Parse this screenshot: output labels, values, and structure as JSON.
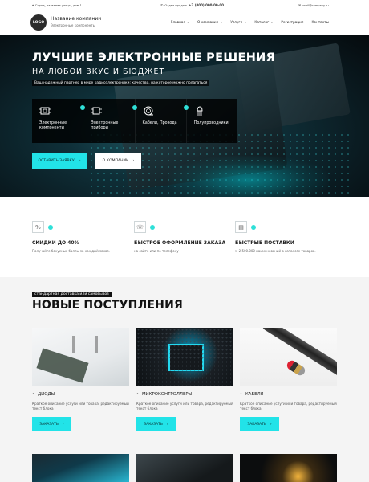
{
  "header": {
    "address": "Город, название улицы, дом 1",
    "order_label": "Отдел продаж",
    "phone": "+7 (000) 000-00-00",
    "email": "mail@company.ru",
    "logo": "LOGO",
    "company_name": "Название компании",
    "company_sub": "Электронные компоненты",
    "nav": [
      {
        "label": "Главная",
        "has_dropdown": true
      },
      {
        "label": "О компании",
        "has_dropdown": true
      },
      {
        "label": "Услуги",
        "has_dropdown": true
      },
      {
        "label": "Каталог",
        "has_dropdown": true
      },
      {
        "label": "Регистрация",
        "has_dropdown": false
      },
      {
        "label": "Контакты",
        "has_dropdown": false
      }
    ]
  },
  "hero": {
    "title": "ЛУЧШИЕ ЭЛЕКТРОННЫЕ РЕШЕНИЯ",
    "subtitle": "НА ЛЮБОЙ ВКУС И БЮДЖЕТ",
    "tagline": "Ваш надежный партнер в мире радиоэлектроники: качество, на которое можно полагаться",
    "categories": [
      {
        "icon": "ic-chip-icon",
        "label": "Электронные компоненты"
      },
      {
        "icon": "ic-board-icon",
        "label": "Электронные приборы"
      },
      {
        "icon": "cable-coil-icon",
        "label": "Кабели, Провода"
      },
      {
        "icon": "transistor-icon",
        "label": "Полупроводники"
      }
    ],
    "btn_order": "ОСТАВИТЬ ЗАЯВКУ",
    "btn_about": "О КОМПАНИИ",
    "accent_color": "#22e3e8"
  },
  "features": [
    {
      "icon": "percent-icon",
      "title": "СКИДКИ ДО 40%",
      "desc": "Получайте бонусные баллы за каждый заказ."
    },
    {
      "icon": "phone-cart-icon",
      "title": "БЫСТРОЕ ОФОРМЛЕНИЕ ЗАКАЗА",
      "desc": "на сайте или по телефону"
    },
    {
      "icon": "catalog-icon",
      "title": "БЫСТРЫЕ ПОСТАВКИ",
      "desc": "> 2.500.000 наименований в каталоге товаров."
    }
  ],
  "arrivals": {
    "tag": "стандартная доставка или самовывоз",
    "title": "НОВЫЕ ПОСТУПЛЕНИЯ",
    "products": [
      {
        "name": "ДИОДЫ",
        "desc": "Краткое описание услуги или товара, редактируемый текст блока",
        "btn": "ЗАКАЗАТЬ"
      },
      {
        "name": "МИКРОКОНТРОЛЛЕРЫ",
        "desc": "Краткое описание услуги или товара, редактируемый текст блока",
        "btn": "ЗАКАЗАТЬ"
      },
      {
        "name": "КАБЕЛЯ",
        "desc": "Краткое описание услуги или товара, редактируемый текст блока",
        "btn": "ЗАКАЗАТЬ"
      }
    ]
  }
}
